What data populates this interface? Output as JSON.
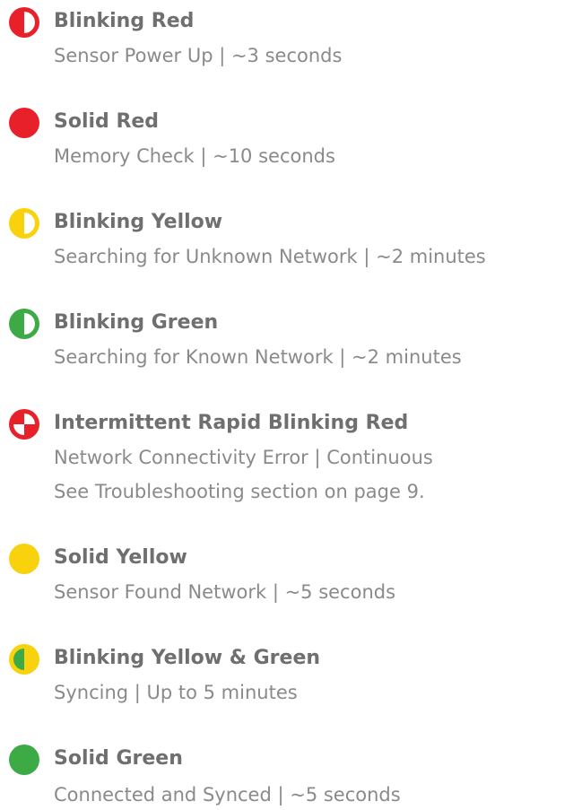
{
  "colors": {
    "red": "#e8202a",
    "yellow": "#f8d20c",
    "green": "#3caa45",
    "white": "#ffffff",
    "title_text": "#6f6f6f",
    "desc_text": "#8a8a8a"
  },
  "statuses": [
    {
      "icon": "blinking-red-icon",
      "title": "Blinking Red",
      "description": "Sensor Power Up | ~3 seconds"
    },
    {
      "icon": "solid-red-icon",
      "title": "Solid Red",
      "description": "Memory Check | ~10 seconds"
    },
    {
      "icon": "blinking-yellow-icon",
      "title": "Blinking Yellow",
      "description": "Searching for Unknown Network | ~2 minutes"
    },
    {
      "icon": "blinking-green-icon",
      "title": "Blinking Green",
      "description": "Searching for Known Network | ~2 minutes"
    },
    {
      "icon": "rapid-blinking-red-icon",
      "title": "Intermittent Rapid Blinking Red",
      "description": "Network Connectivity Error | Continuous",
      "note": "See Troubleshooting section on page 9."
    },
    {
      "icon": "solid-yellow-icon",
      "title": "Solid Yellow",
      "description": "Sensor Found Network | ~5 seconds"
    },
    {
      "icon": "blinking-yellow-green-icon",
      "title": "Blinking Yellow & Green",
      "description": "Syncing | Up to 5 minutes"
    },
    {
      "icon": "solid-green-icon",
      "title": "Solid Green",
      "description": "Connected and Synced | ~5 seconds"
    }
  ]
}
